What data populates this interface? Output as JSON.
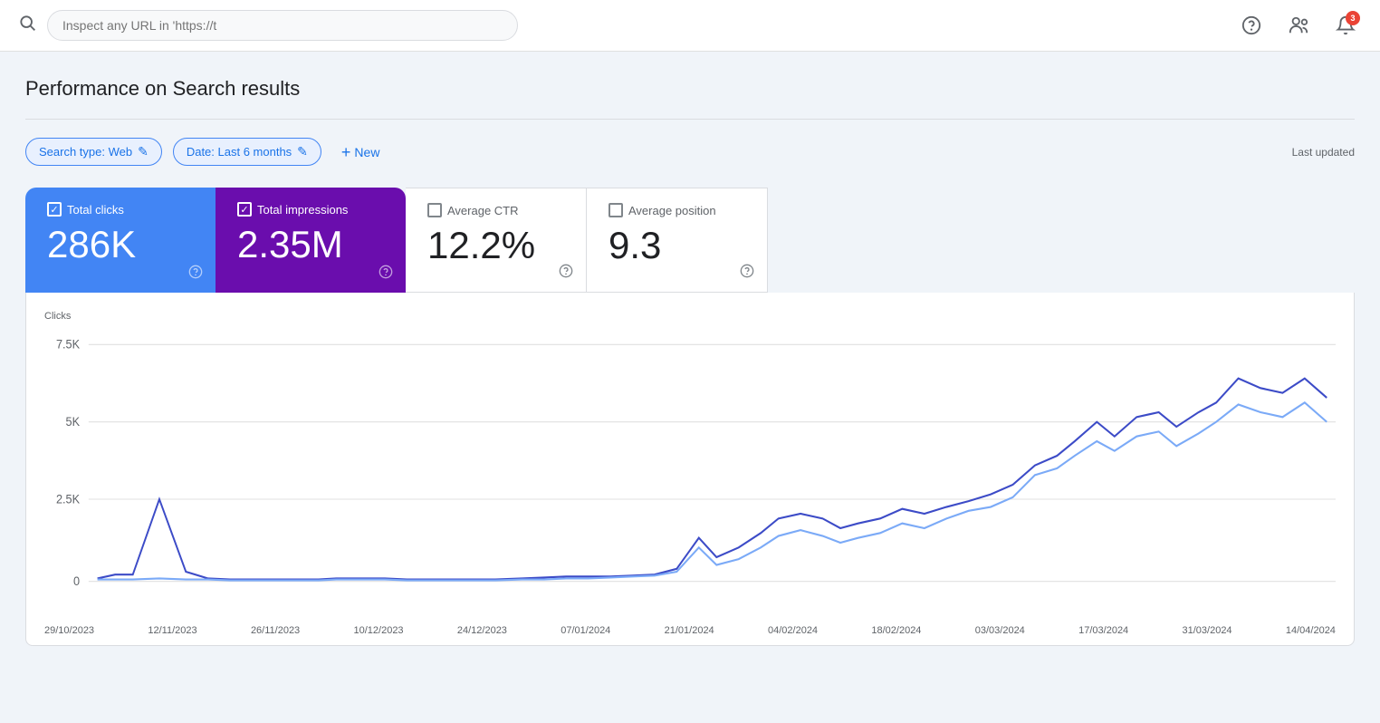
{
  "topBar": {
    "urlPlaceholder": "Inspect any URL in 'https://t",
    "urlValue": "Inspect any URL in 'https://t"
  },
  "header": {
    "title": "Performance on Search results"
  },
  "filters": {
    "searchType": "Search type: Web",
    "date": "Date: Last 6 months",
    "newLabel": "New",
    "lastUpdated": "Last updated"
  },
  "metrics": [
    {
      "id": "total-clicks",
      "label": "Total clicks",
      "value": "286K",
      "checked": true,
      "type": "blue"
    },
    {
      "id": "total-impressions",
      "label": "Total impressions",
      "value": "2.35M",
      "checked": true,
      "type": "purple"
    },
    {
      "id": "avg-ctr",
      "label": "Average CTR",
      "value": "12.2%",
      "checked": false,
      "type": "white"
    },
    {
      "id": "avg-position",
      "label": "Average position",
      "value": "9.3",
      "checked": false,
      "type": "white"
    }
  ],
  "chart": {
    "yLabel": "Clicks",
    "yTicks": [
      "7.5K",
      "5K",
      "2.5K",
      "0"
    ],
    "xLabels": [
      "29/10/2023",
      "12/11/2023",
      "26/11/2023",
      "10/12/2023",
      "24/12/2023",
      "07/01/2024",
      "21/01/2024",
      "04/02/2024",
      "18/02/2024",
      "03/03/2024",
      "17/03/2024",
      "31/03/2024",
      "14/04/2024"
    ],
    "colors": {
      "line1": "#3c4bc7",
      "line2": "#7baaf7"
    }
  },
  "icons": {
    "search": "🔍",
    "help": "?",
    "people": "👤",
    "notification": "🔔",
    "notifCount": "3",
    "edit": "✏",
    "plus": "+",
    "check": "✓"
  }
}
